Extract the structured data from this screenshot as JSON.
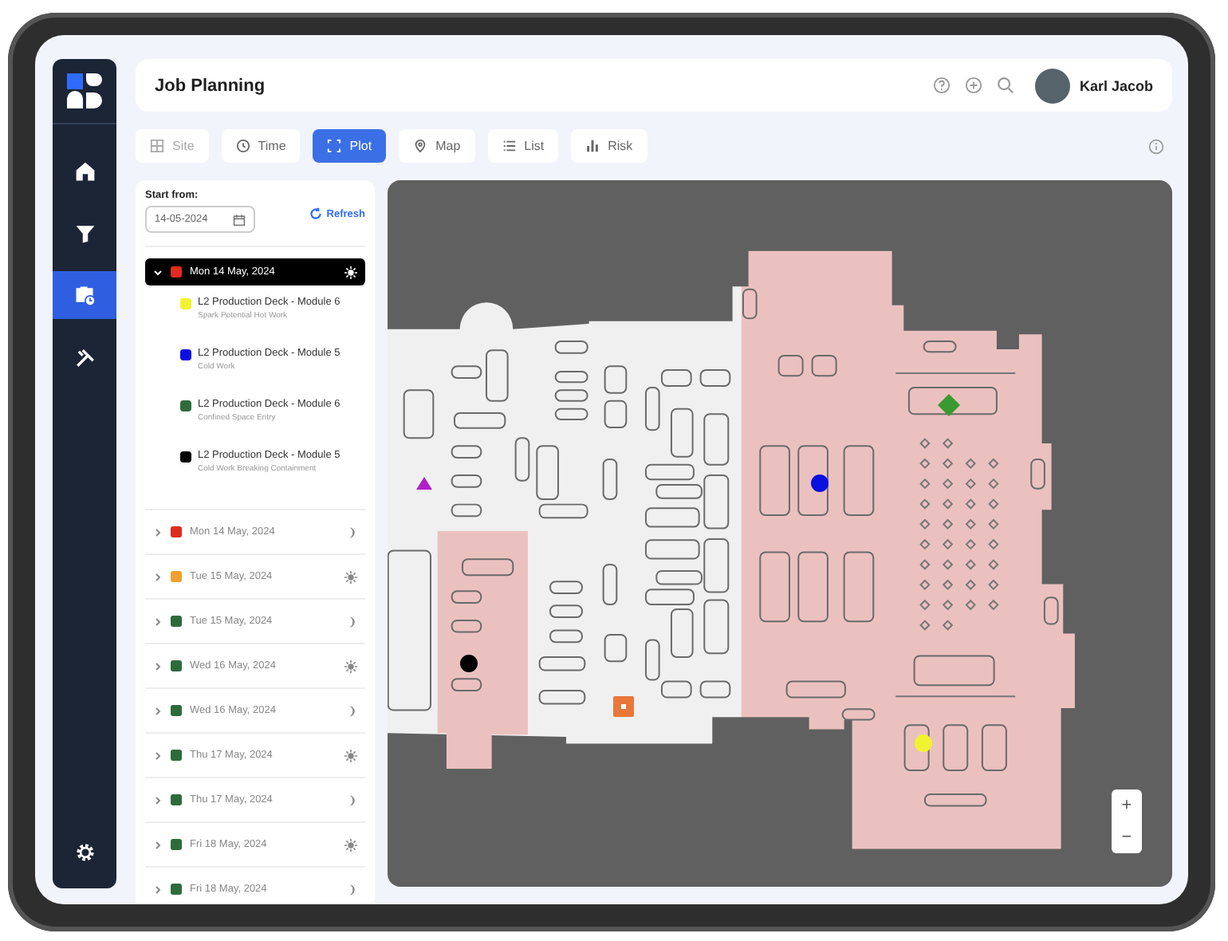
{
  "header": {
    "title": "Job Planning",
    "user": {
      "name": "Karl Jacob"
    }
  },
  "tabs": [
    {
      "label": "Site",
      "selected": false,
      "disabled": true
    },
    {
      "label": "Time",
      "selected": false,
      "disabled": false
    },
    {
      "label": "Plot",
      "selected": true,
      "disabled": false
    },
    {
      "label": "Map",
      "selected": false,
      "disabled": false
    },
    {
      "label": "List",
      "selected": false,
      "disabled": false
    },
    {
      "label": "Risk",
      "selected": false,
      "disabled": false
    }
  ],
  "filter": {
    "label": "Start from:",
    "date": "14-05-2024",
    "refresh": "Refresh"
  },
  "days": [
    {
      "label": "Mon 14 May, 2024",
      "color": "#e02b20",
      "kind": "day",
      "selected": true,
      "expanded": true,
      "jobs": [
        {
          "title": "L2 Production Deck - Module 6",
          "subtitle": "Spark Potential Hot Work",
          "color": "#f2f230"
        },
        {
          "title": "L2 Production Deck - Module 5",
          "subtitle": "Cold Work",
          "color": "#0a10e0"
        },
        {
          "title": "L2 Production Deck - Module 6",
          "subtitle": "Confined Space Entry",
          "color": "#2e6b3c"
        },
        {
          "title": "L2 Production Deck - Module 5",
          "subtitle": "Cold Work Breaking Containment",
          "color": "#000000"
        }
      ]
    },
    {
      "label": "Mon 14 May, 2024",
      "color": "#e02b20",
      "kind": "night",
      "selected": false,
      "expanded": false
    },
    {
      "label": "Tue 15 May, 2024",
      "color": "#f0a030",
      "kind": "day",
      "selected": false,
      "expanded": false
    },
    {
      "label": "Tue 15 May, 2024",
      "color": "#2e6b3c",
      "kind": "night",
      "selected": false,
      "expanded": false
    },
    {
      "label": "Wed 16 May, 2024",
      "color": "#2e6b3c",
      "kind": "day",
      "selected": false,
      "expanded": false
    },
    {
      "label": "Wed 16 May, 2024",
      "color": "#2e6b3c",
      "kind": "night",
      "selected": false,
      "expanded": false
    },
    {
      "label": "Thu 17 May, 2024",
      "color": "#2e6b3c",
      "kind": "day",
      "selected": false,
      "expanded": false
    },
    {
      "label": "Thu 17 May, 2024",
      "color": "#2e6b3c",
      "kind": "night",
      "selected": false,
      "expanded": false
    },
    {
      "label": "Fri 18 May, 2024",
      "color": "#2e6b3c",
      "kind": "day",
      "selected": false,
      "expanded": false
    },
    {
      "label": "Fri 18 May, 2024",
      "color": "#2e6b3c",
      "kind": "night",
      "selected": false,
      "expanded": false
    }
  ],
  "map": {
    "markers": [
      {
        "kind": "triangle",
        "color": "#b020c8"
      },
      {
        "kind": "circle",
        "color": "#000000"
      },
      {
        "kind": "square",
        "color": "#e8773a"
      },
      {
        "kind": "circle",
        "color": "#0a10e0"
      },
      {
        "kind": "diamond",
        "color": "#3a9a30"
      },
      {
        "kind": "circle",
        "color": "#f2f230"
      }
    ],
    "zoom_in": "+",
    "zoom_out": "−"
  }
}
